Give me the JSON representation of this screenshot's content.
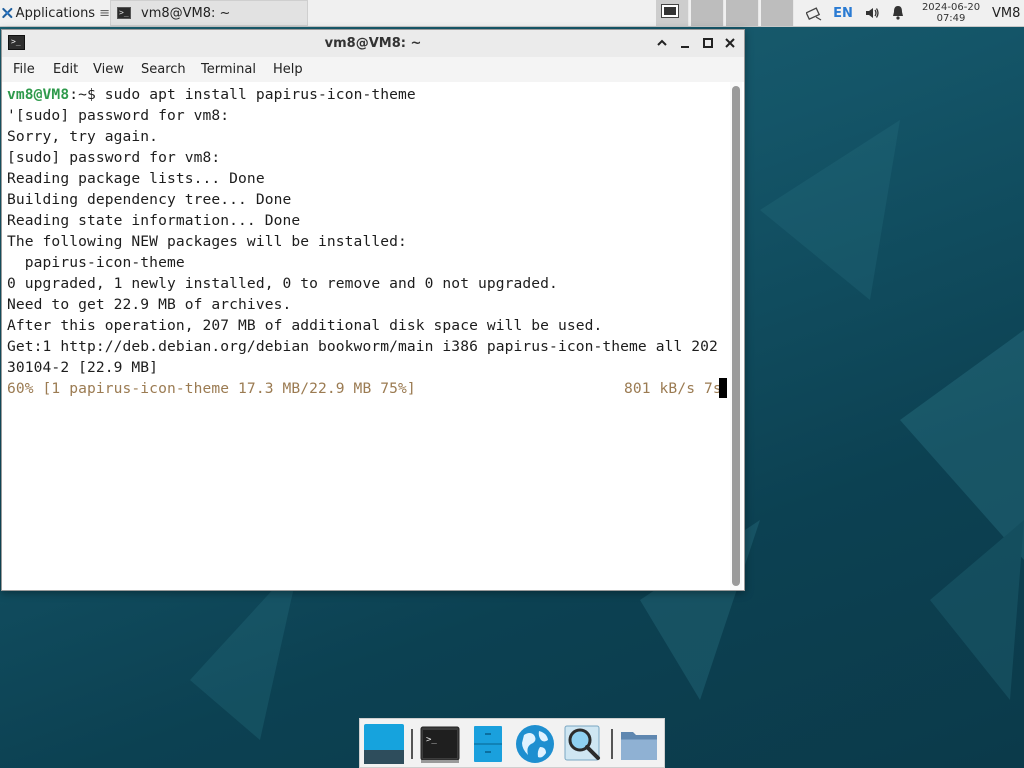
{
  "top_panel": {
    "applications_label": "Applications",
    "applications_suffix": "≡",
    "task_title": "vm8@VM8: ~",
    "language": "EN",
    "clock_date": "2024-06-20",
    "clock_time": "07:49",
    "user": "VM8"
  },
  "window": {
    "title": "vm8@VM8: ~",
    "menu": [
      "File",
      "Edit",
      "View",
      "Search",
      "Terminal",
      "Help"
    ]
  },
  "terminal": {
    "prompt_user": "vm8@VM8",
    "prompt_rest": ":~$ sudo apt install papirus-icon-theme",
    "lines": [
      "'[sudo] password for vm8:",
      "Sorry, try again.",
      "[sudo] password for vm8:",
      "Reading package lists... Done",
      "Building dependency tree... Done",
      "Reading state information... Done",
      "The following NEW packages will be installed:",
      "  papirus-icon-theme",
      "0 upgraded, 1 newly installed, 0 to remove and 0 not upgraded.",
      "Need to get 22.9 MB of archives.",
      "After this operation, 207 MB of additional disk space will be used.",
      "Get:1 http://deb.debian.org/debian bookworm/main i386 papirus-icon-theme all 202",
      "30104-2 [22.9 MB]"
    ],
    "progress_left": "60% [1 papirus-icon-theme 17.3 MB/22.9 MB 75%]",
    "progress_right": "801 kB/s 7s"
  },
  "dock": {
    "items": [
      "show-desktop",
      "terminal",
      "file-manager",
      "web-browser",
      "app-finder",
      "folder"
    ]
  },
  "colors": {
    "prompt_green": "#2f9a4c",
    "progress_brown": "#9b7b52",
    "desktop_teal": "#145568"
  }
}
